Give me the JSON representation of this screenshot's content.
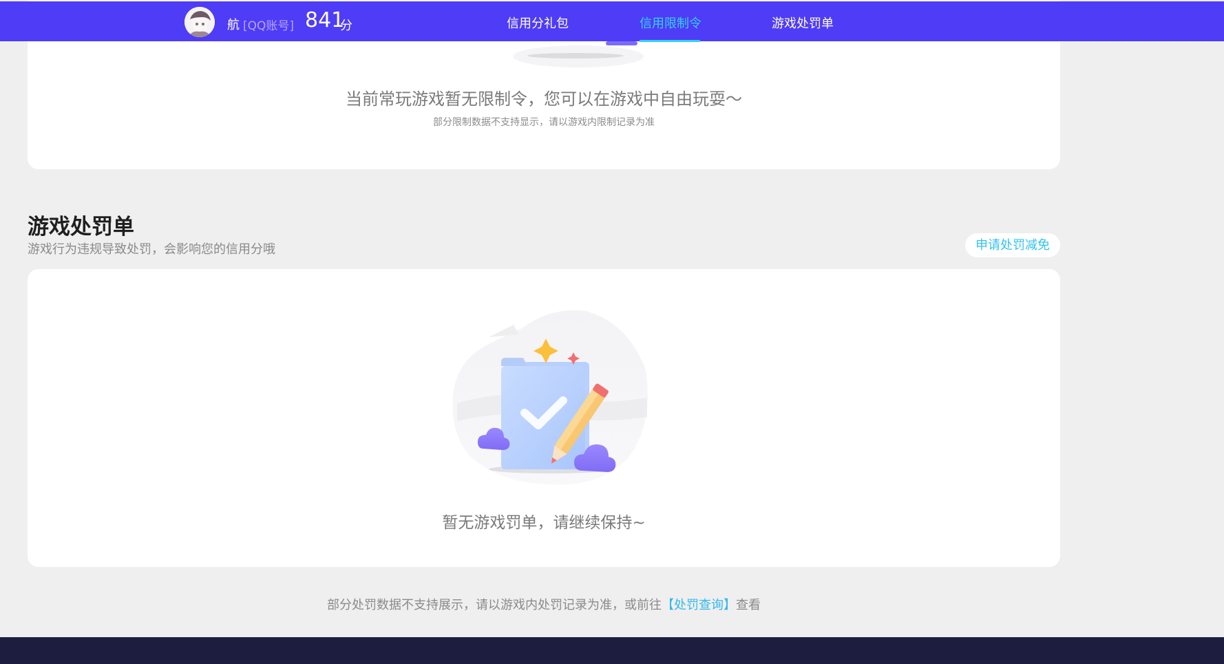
{
  "header": {
    "user_name": "航",
    "account_type": "[QQ账号]",
    "score": "841",
    "score_unit": "分",
    "tabs": [
      {
        "label": "信用分礼包",
        "active": false
      },
      {
        "label": "信用限制令",
        "active": true
      },
      {
        "label": "游戏处罚单",
        "active": false
      }
    ]
  },
  "restriction": {
    "message": "当前常玩游戏暂无限制令，您可以在游戏中自由玩耍～",
    "note": "部分限制数据不支持显示，请以游戏内限制记录为准"
  },
  "penalty": {
    "title": "游戏处罚单",
    "subtitle": "游戏行为违规导致处罚，会影响您的信用分哦",
    "appeal_button": "申请处罚减免",
    "empty_message": "暂无游戏罚单，请继续保持~"
  },
  "footer": {
    "note_prefix": "部分处罚数据不支持展示，请以游戏内处罚记录为准，或前往",
    "link_label": "【处罚查询】",
    "note_suffix": "查看"
  },
  "colors": {
    "header_bg": "#4f3cf6",
    "accent": "#33d1f5",
    "page_bg": "#efefef",
    "bottom_band": "#1d1e3f"
  },
  "icons": [
    "avatar-image",
    "clipboard-check-icon",
    "pencil-icon",
    "cloud-icon",
    "sparkle-icon"
  ]
}
